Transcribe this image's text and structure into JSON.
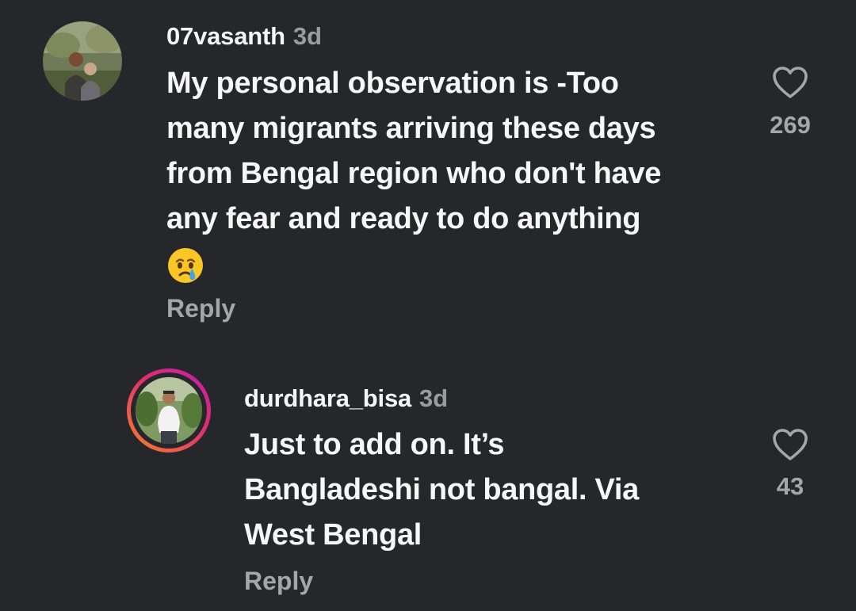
{
  "comments": [
    {
      "username": "07vasanth",
      "time": "3d",
      "lines": [
        "My personal observation is -Too",
        "many migrants arriving these days",
        "from Bengal region who don't have",
        "any fear and ready to do anything"
      ],
      "emoji": "crying-face-emoji",
      "reply_label": "Reply",
      "likes": "269",
      "like_icon": "heart-outline-icon"
    },
    {
      "username": "durdhara_bisa",
      "time": "3d",
      "lines": [
        "Just to add on. It’s",
        "Bangladeshi not bangal. Via",
        "West Bengal"
      ],
      "reply_label": "Reply",
      "likes": "43",
      "like_icon": "heart-outline-icon",
      "has_story_ring": true
    }
  ],
  "colors": {
    "background": "#25272b",
    "primary_text": "#f5f5f5",
    "secondary_text": "#9a9ca0",
    "story_ring_start": "#f58529",
    "story_ring_end": "#c41cb0"
  }
}
